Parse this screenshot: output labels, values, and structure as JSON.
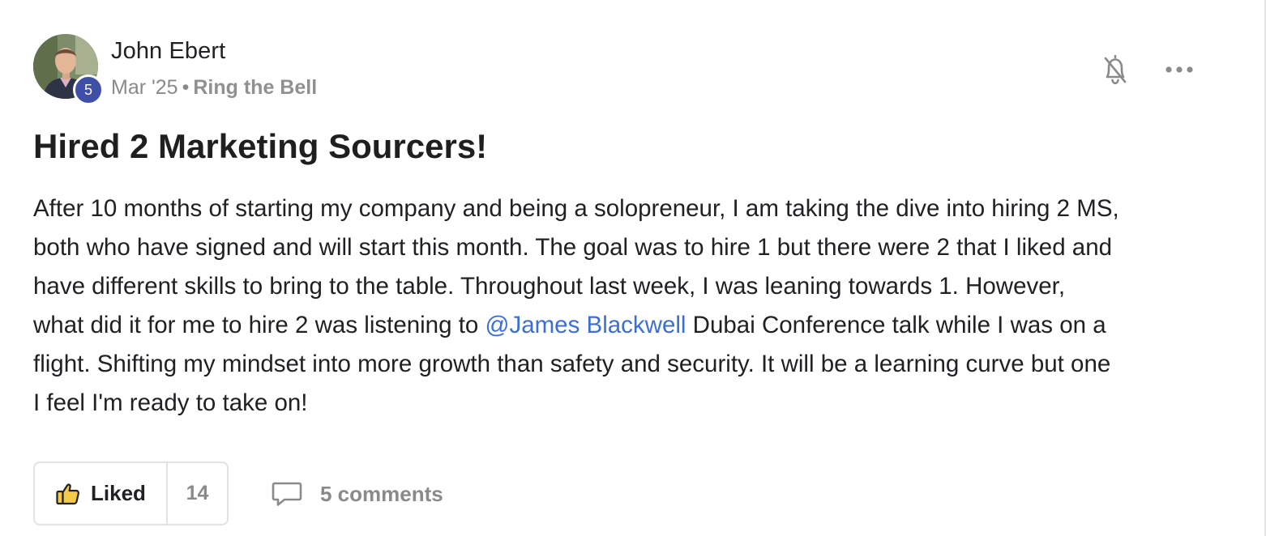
{
  "post": {
    "author": {
      "name": "John Ebert",
      "level": "5"
    },
    "meta": {
      "date": "Mar '25",
      "separator": "•",
      "category": "Ring the Bell"
    },
    "title": "Hired 2 Marketing Sourcers!",
    "body_lines": [
      {
        "text": "After 10 months of starting my company and being a solopreneur, I am taking the dive into hiring 2 MS,"
      },
      {
        "text": "both who have signed and will start this month. The goal was to hire 1 but there were 2 that I liked and"
      },
      {
        "text": "have different skills to bring to the table. Throughout last week, I was leaning towards 1. However,"
      },
      {
        "before": "what did it for me to hire 2 was listening to ",
        "mention": "@James Blackwell",
        "after": " Dubai Conference talk while I was on a"
      },
      {
        "text": "flight. Shifting my mindset into more growth than safety and security. It will be a learning curve but one"
      },
      {
        "text": "I feel I'm ready to take on!"
      }
    ],
    "reactions": {
      "like_label": "Liked",
      "like_count": "14",
      "comments_label": "5 comments"
    }
  },
  "icons": {
    "bell": "bell-off-icon",
    "more": "more-horizontal-icon",
    "like": "thumbs-up-icon",
    "comment": "comment-icon"
  },
  "colors": {
    "level_badge": "#3f4ea6",
    "mention": "#3b6fd6",
    "muted_text": "#8a8a8a",
    "like_icon_fill": "#f7c948"
  }
}
